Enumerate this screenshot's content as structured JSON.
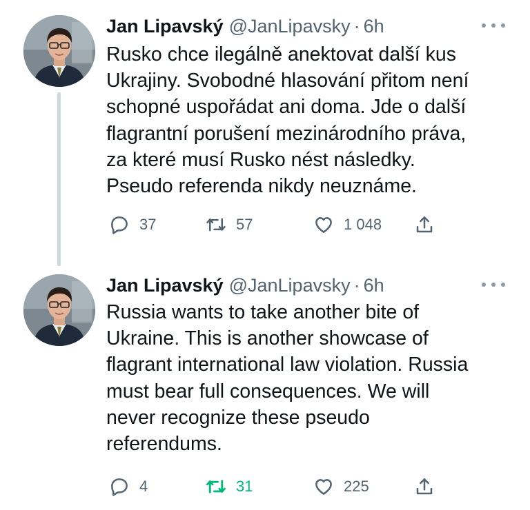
{
  "colors": {
    "text_primary": "#0f1419",
    "text_secondary": "#536471",
    "retweet_active": "#00ba7c",
    "thread_line": "#cfd9de"
  },
  "tweets": [
    {
      "author": {
        "display_name": "Jan Lipavský",
        "handle": "@JanLipavsky",
        "separator": "·",
        "time": "6h"
      },
      "avatar_icon": "profile-photo",
      "lines": [
        "Rusko chce ilegálně anektovat další kus",
        "Ukrajiny. Svobodné hlasování přitom není",
        "schopné uspořádat ani doma. Jde o další",
        "flagrantní porušení mezinárodního práva,",
        "za které musí Rusko nést následky.",
        "Pseudo referenda nikdy neuznáme."
      ],
      "actions": {
        "replies": "37",
        "retweets": "57",
        "likes": "1 048",
        "retweeted": false
      }
    },
    {
      "author": {
        "display_name": "Jan Lipavský",
        "handle": "@JanLipavsky",
        "separator": "·",
        "time": "6h"
      },
      "avatar_icon": "profile-photo",
      "lines": [
        "Russia wants to take another bite of",
        "Ukraine. This is another showcase of",
        "flagrant international law violation. Russia",
        "must bear full consequences. We will",
        "never recognize these pseudo",
        "referendums."
      ],
      "actions": {
        "replies": "4",
        "retweets": "31",
        "likes": "225",
        "retweeted": true
      }
    }
  ]
}
